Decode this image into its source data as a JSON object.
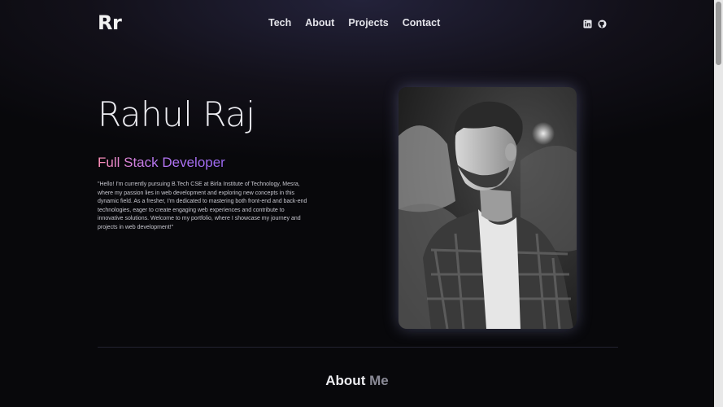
{
  "header": {
    "logo": "Rr",
    "nav": [
      "Tech",
      "About",
      "Projects",
      "Contact"
    ],
    "social_icons": [
      "linkedin-icon",
      "github-icon"
    ]
  },
  "hero": {
    "name": "Rahul Raj",
    "role": "Full Stack Developer",
    "intro": "\"Hello! I'm currently pursuing B.Tech CSE at Birla Institute of Technology, Mesra, where my passion lies in web development and exploring new concepts in this dynamic field. As a fresher, I'm dedicated to mastering both front-end and back-end technologies, eager to create engaging web experiences and contribute to innovative solutions. Welcome to my portfolio, where I showcase my journey and projects in web development!\""
  },
  "about": {
    "title_part1": "About",
    "title_part2": "Me"
  },
  "colors": {
    "role_gradient_start": "#ff8fb7",
    "role_gradient_end": "#9a68f0"
  }
}
